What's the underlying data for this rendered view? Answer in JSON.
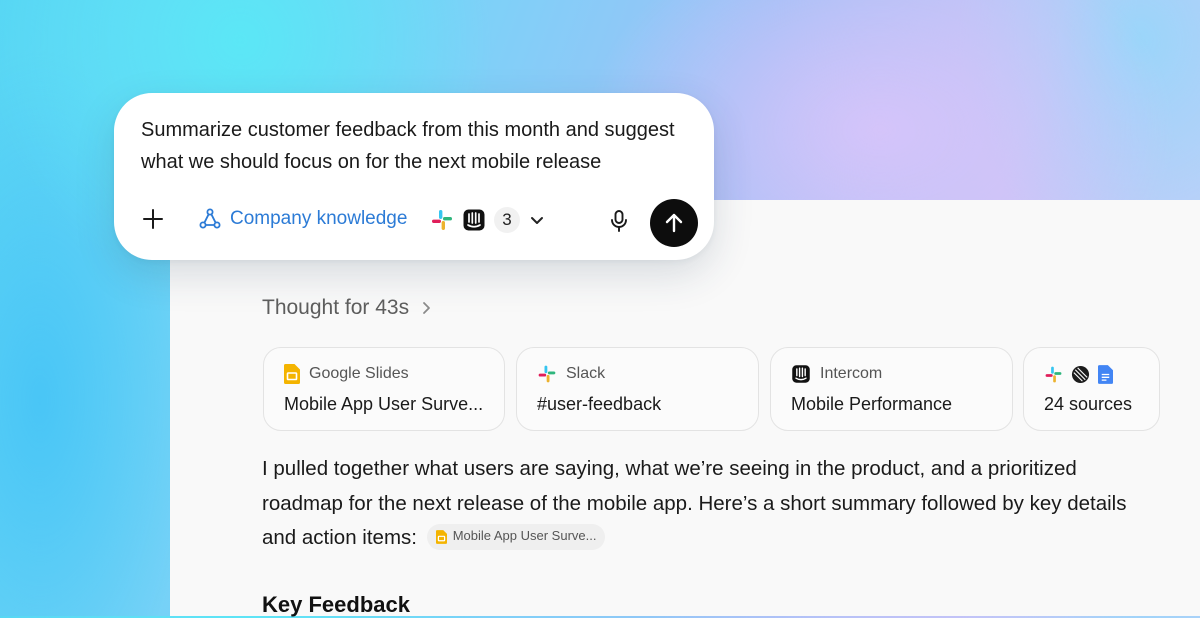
{
  "composer": {
    "prompt": "Summarize customer feedback from this month and suggest what we should focus on for the next mobile release",
    "knowledge_label": "Company knowledge",
    "connector_icons": [
      "slack-icon",
      "intercom-icon"
    ],
    "connector_count": "3"
  },
  "thought": {
    "label": "Thought for 43s"
  },
  "sources": [
    {
      "app": "Google Slides",
      "title": "Mobile App User Surve...",
      "icon": "google-slides-icon"
    },
    {
      "app": "Slack",
      "title": "#user-feedback",
      "icon": "slack-icon"
    },
    {
      "app": "Intercom",
      "title": "Mobile Performance",
      "icon": "intercom-icon"
    },
    {
      "icons": [
        "slack-icon",
        "linear-icon",
        "google-docs-icon"
      ],
      "title": "24 sources"
    }
  ],
  "response": {
    "text": "I pulled together what users are saying, what we’re seeing in the product, and a prioritized roadmap for the next release of the mobile app. Here’s a short summary followed by key details and action items:",
    "chip_label": "Mobile App User Surve...",
    "heading": "Key Feedback"
  },
  "colors": {
    "accent_link": "#2c7bd6",
    "send_button": "#0d0d0d",
    "slides_yellow": "#f4b400",
    "docs_blue": "#4285f4"
  }
}
